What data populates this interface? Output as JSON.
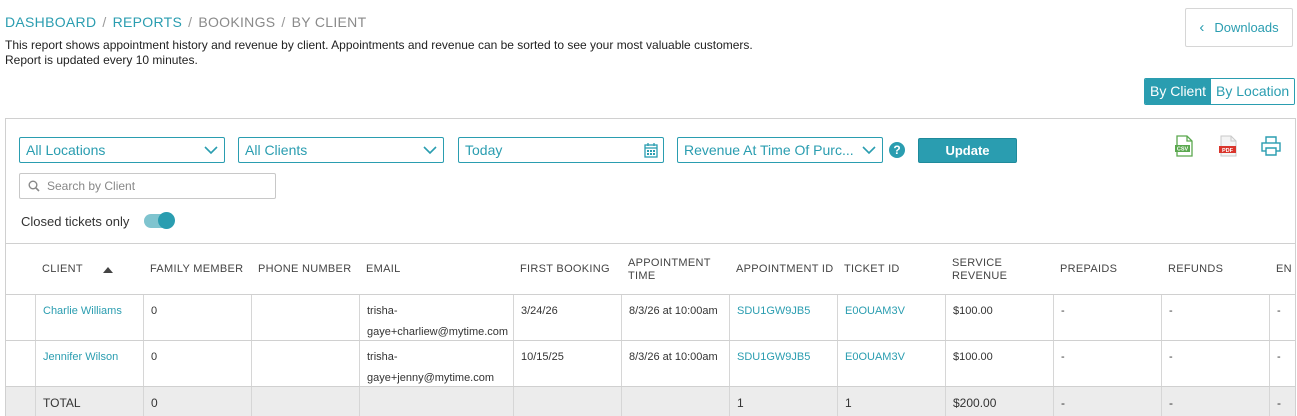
{
  "breadcrumb": {
    "dashboard": "DASHBOARD",
    "reports": "REPORTS",
    "bookings": "BOOKINGS",
    "by_client": "BY CLIENT",
    "separator": "/"
  },
  "description": {
    "line1": "This report shows appointment history and revenue by client. Appointments and revenue can be sorted to see your most valuable customers.",
    "line2": "Report is updated every 10 minutes."
  },
  "downloads": {
    "label": "Downloads",
    "chevron": "‹"
  },
  "view_toggle": {
    "by_client": "By Client",
    "by_location": "By Location",
    "active": "by_client"
  },
  "filters": {
    "locations": "All Locations",
    "clients": "All Clients",
    "date": "Today",
    "revenue_mode": "Revenue At Time Of Purc...",
    "help": "?",
    "update": "Update",
    "search_placeholder": "Search by Client",
    "closed_tickets_label": "Closed tickets only",
    "closed_tickets_on": true
  },
  "icons": {
    "csv": "csv-export-icon",
    "pdf": "pdf-export-icon",
    "print": "print-icon",
    "search": "search-icon",
    "calendar": "calendar-icon",
    "chevron": "chevron-down-icon",
    "sort": "sort-ascending-icon"
  },
  "colors": {
    "accent": "#2a9db0",
    "pdf": "#d9342b",
    "csv": "#5aa84e",
    "total_row": "#ececec"
  },
  "table": {
    "headers": {
      "client": "CLIENT",
      "family_member": "FAMILY MEMBER",
      "phone": "PHONE NUMBER",
      "email": "EMAIL",
      "first_booking": "FIRST BOOKING",
      "appointment_time_1": "APPOINTMENT",
      "appointment_time_2": "TIME",
      "appointment_id": "APPOINTMENT ID",
      "ticket_id": "TICKET ID",
      "service_revenue_1": "SERVICE",
      "service_revenue_2": "REVENUE",
      "prepaids": "PREPAIDS",
      "refunds": "REFUNDS",
      "next": "EN"
    },
    "rows": [
      {
        "client": "Charlie Williams",
        "family_member": "0",
        "phone": "",
        "email_1": "trisha-",
        "email_2": "gaye+charliew@mytime.com",
        "first_booking": "3/24/26",
        "appointment_time": "8/3/26 at 10:00am",
        "appointment_id": "SDU1GW9JB5",
        "ticket_id": "E0OUAM3V",
        "service_revenue": "$100.00",
        "prepaids": "-",
        "refunds": "-",
        "next": "-"
      },
      {
        "client": "Jennifer Wilson",
        "family_member": "0",
        "phone": "",
        "email_1": "trisha-",
        "email_2": "gaye+jenny@mytime.com",
        "first_booking": "10/15/25",
        "appointment_time": "8/3/26 at 10:00am",
        "appointment_id": "SDU1GW9JB5",
        "ticket_id": "E0OUAM3V",
        "service_revenue": "$100.00",
        "prepaids": "-",
        "refunds": "-",
        "next": "-"
      }
    ],
    "total": {
      "label": "TOTAL",
      "family_member": "0",
      "appointment_id": "1",
      "ticket_id": "1",
      "service_revenue": "$200.00",
      "prepaids": "-",
      "refunds": "-",
      "next": "-"
    }
  }
}
